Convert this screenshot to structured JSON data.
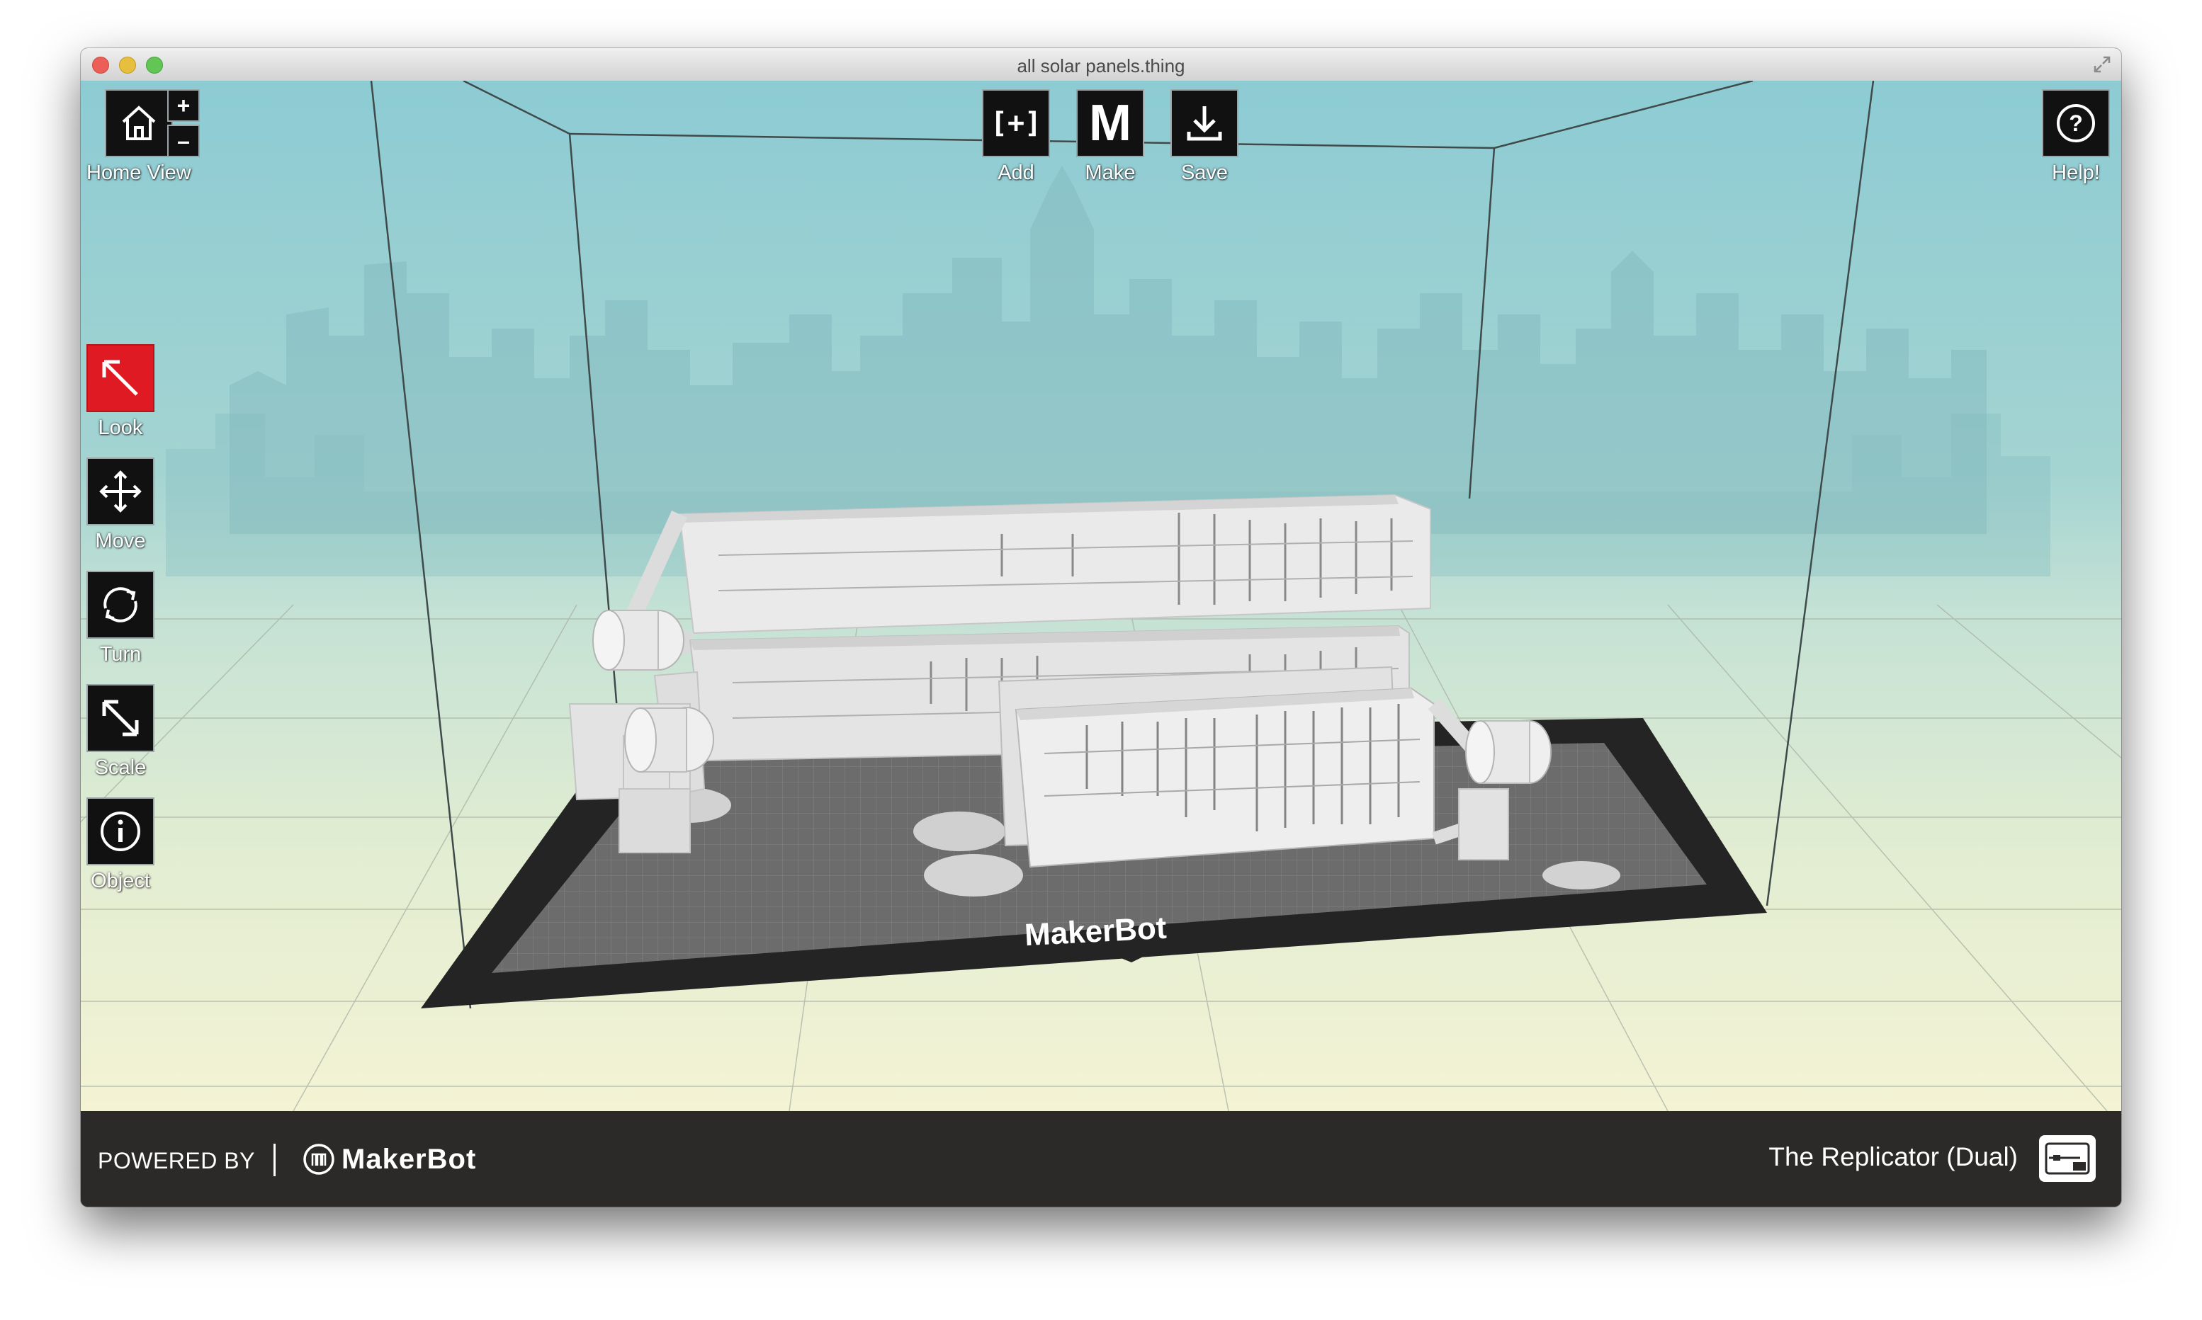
{
  "window": {
    "title": "all solar panels.thing"
  },
  "toolbar": {
    "home_view": "Home View",
    "zoom_in": "+",
    "zoom_out": "–",
    "add_icon_text": "[+]",
    "add": "Add",
    "make_icon_text": "M",
    "make": "Make",
    "save": "Save",
    "help_icon_text": "?",
    "help": "Help!"
  },
  "tools": {
    "look": "Look",
    "move": "Move",
    "turn": "Turn",
    "scale": "Scale",
    "object": "Object",
    "active": "look"
  },
  "plate": {
    "brand": "MakerBot"
  },
  "footer": {
    "powered_by": "POWERED BY",
    "brand": "MakerBot",
    "printer": "The Replicator (Dual)"
  },
  "colors": {
    "accent_red": "#e01a22",
    "sky": "#8fcbd3",
    "floor": "#eef1d6",
    "footer": "#2b2a28"
  }
}
